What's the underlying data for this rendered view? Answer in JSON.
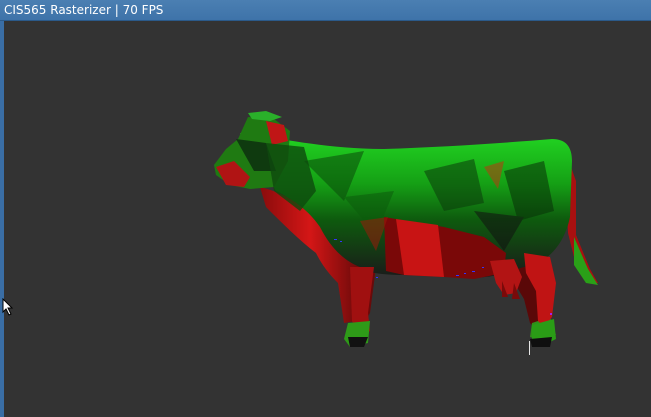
{
  "window": {
    "title": "CIS565 Rasterizer | 70 FPS"
  },
  "viewport": {
    "background_color": "#333333",
    "model": "cow",
    "shading_colors": [
      "#00d000",
      "#c00000",
      "#101010",
      "#3030ff"
    ]
  },
  "icons": {
    "pointer": "mouse-pointer-icon",
    "text_cursor": "text-cursor-icon"
  }
}
